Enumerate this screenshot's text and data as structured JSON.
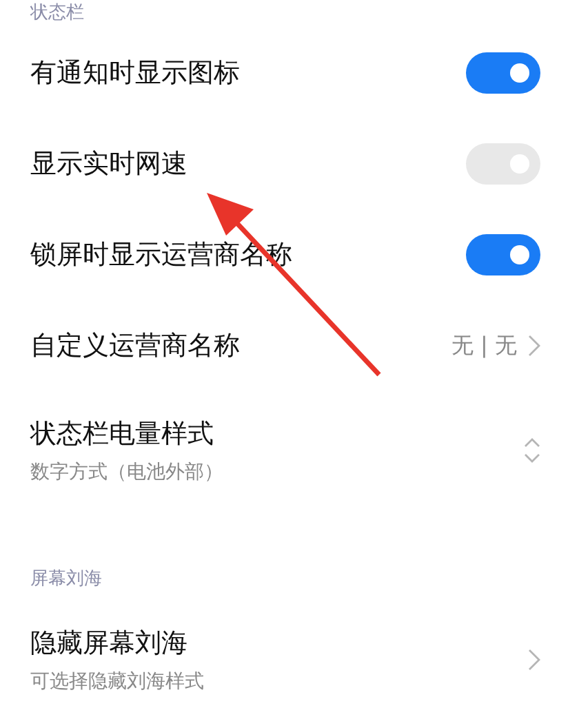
{
  "sections": [
    {
      "header": "状态栏",
      "items": [
        {
          "kind": "toggle",
          "title": "有通知时显示图标",
          "on": true
        },
        {
          "kind": "toggle",
          "title": "显示实时网速",
          "on": false
        },
        {
          "kind": "toggle",
          "title": "锁屏时显示运营商名称",
          "on": true
        },
        {
          "kind": "value",
          "title": "自定义运营商名称",
          "value": "无 | 无"
        },
        {
          "kind": "stepper",
          "title": "状态栏电量样式",
          "subtitle": "数字方式（电池外部）"
        }
      ]
    },
    {
      "header": "屏幕刘海",
      "items": [
        {
          "kind": "chevron",
          "title": "隐藏屏幕刘海",
          "subtitle": "可选择隐藏刘海样式"
        }
      ]
    }
  ]
}
